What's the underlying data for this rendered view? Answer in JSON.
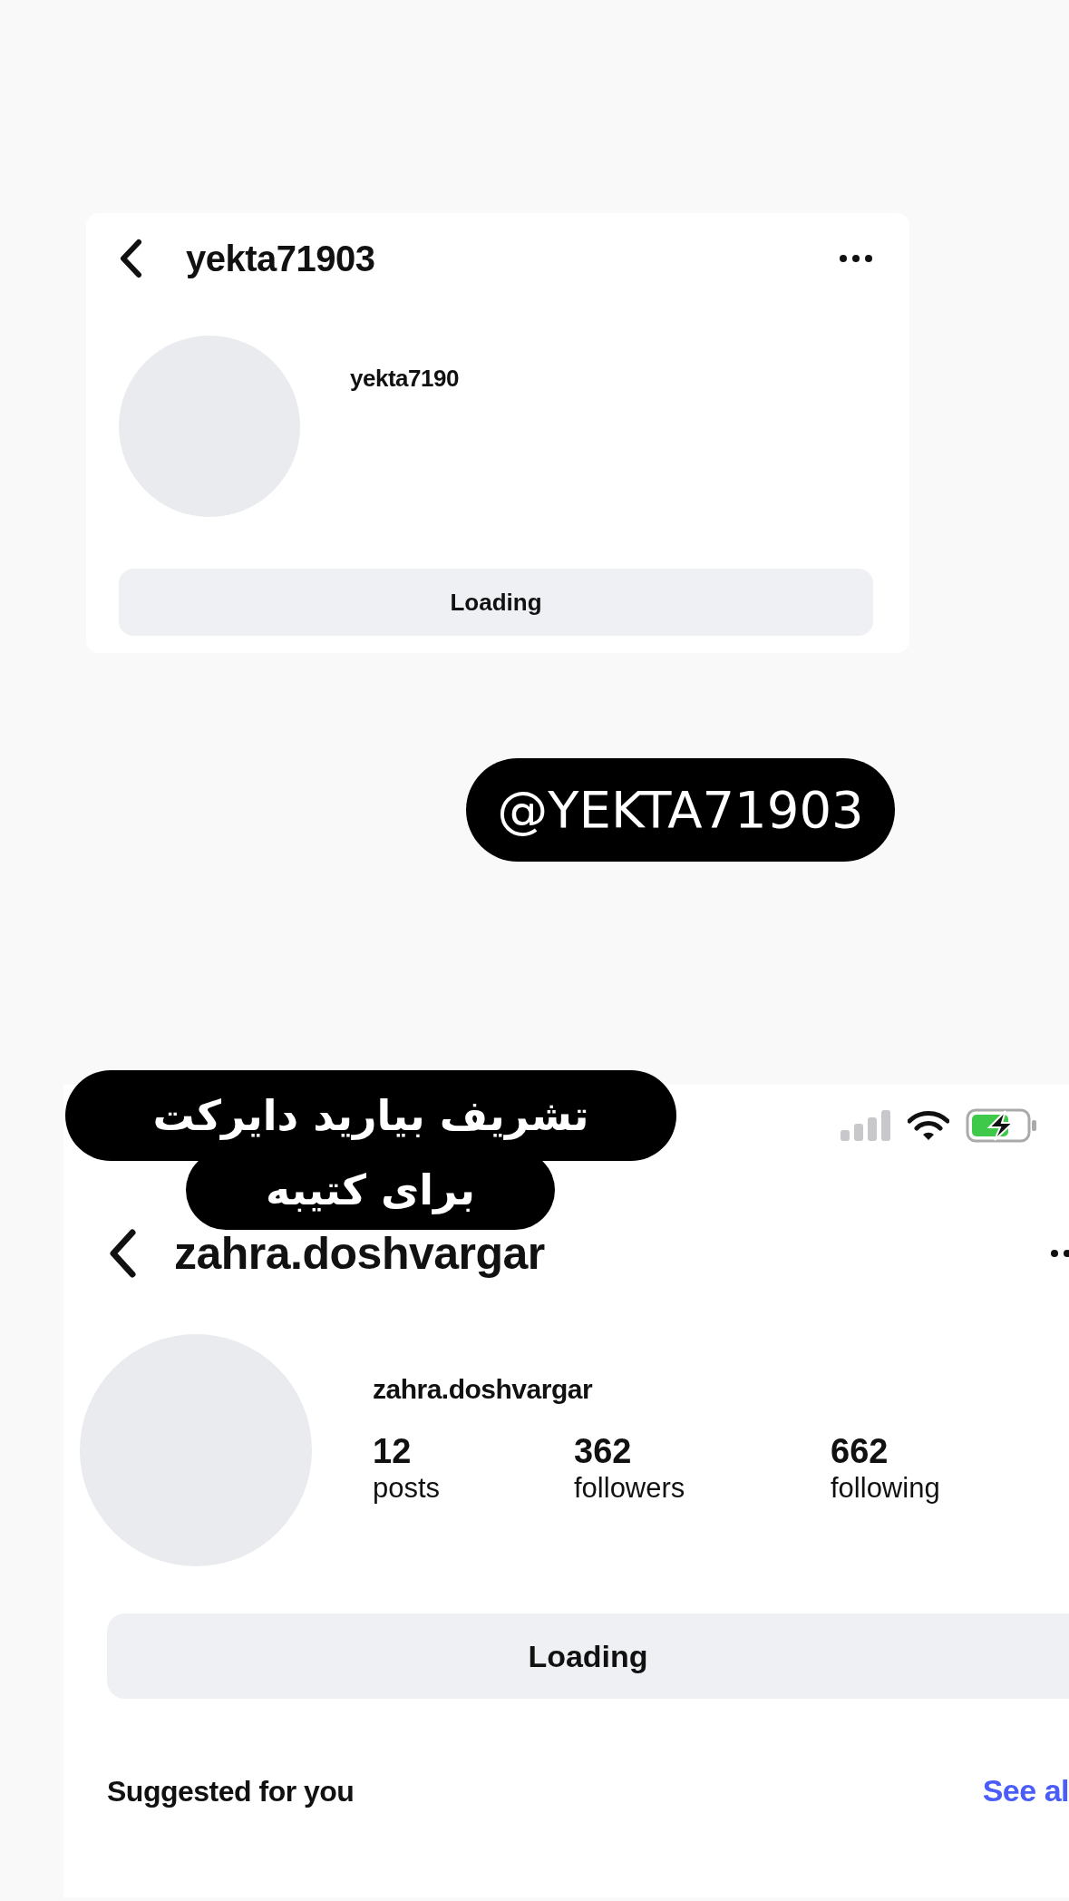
{
  "first_profile": {
    "header": {
      "title": "yekta71903"
    },
    "username": "yekta7190",
    "button": "Loading"
  },
  "sticker": {
    "text": "@YEKTA71903"
  },
  "second_profile": {
    "status_bar": {
      "charging": true
    },
    "header": {
      "title": "zahra.doshvargar"
    },
    "username": "zahra.doshvargar",
    "stats": [
      {
        "value": "12",
        "label": "posts"
      },
      {
        "value": "362",
        "label": "followers"
      },
      {
        "value": "662",
        "label": "following"
      }
    ],
    "button": "Loading",
    "section": {
      "title": "Suggested for you",
      "link": "See al"
    }
  },
  "caption_sticker": {
    "lines": [
      "تشریف بیارید دایرکت",
      "برای کتیبه"
    ]
  }
}
